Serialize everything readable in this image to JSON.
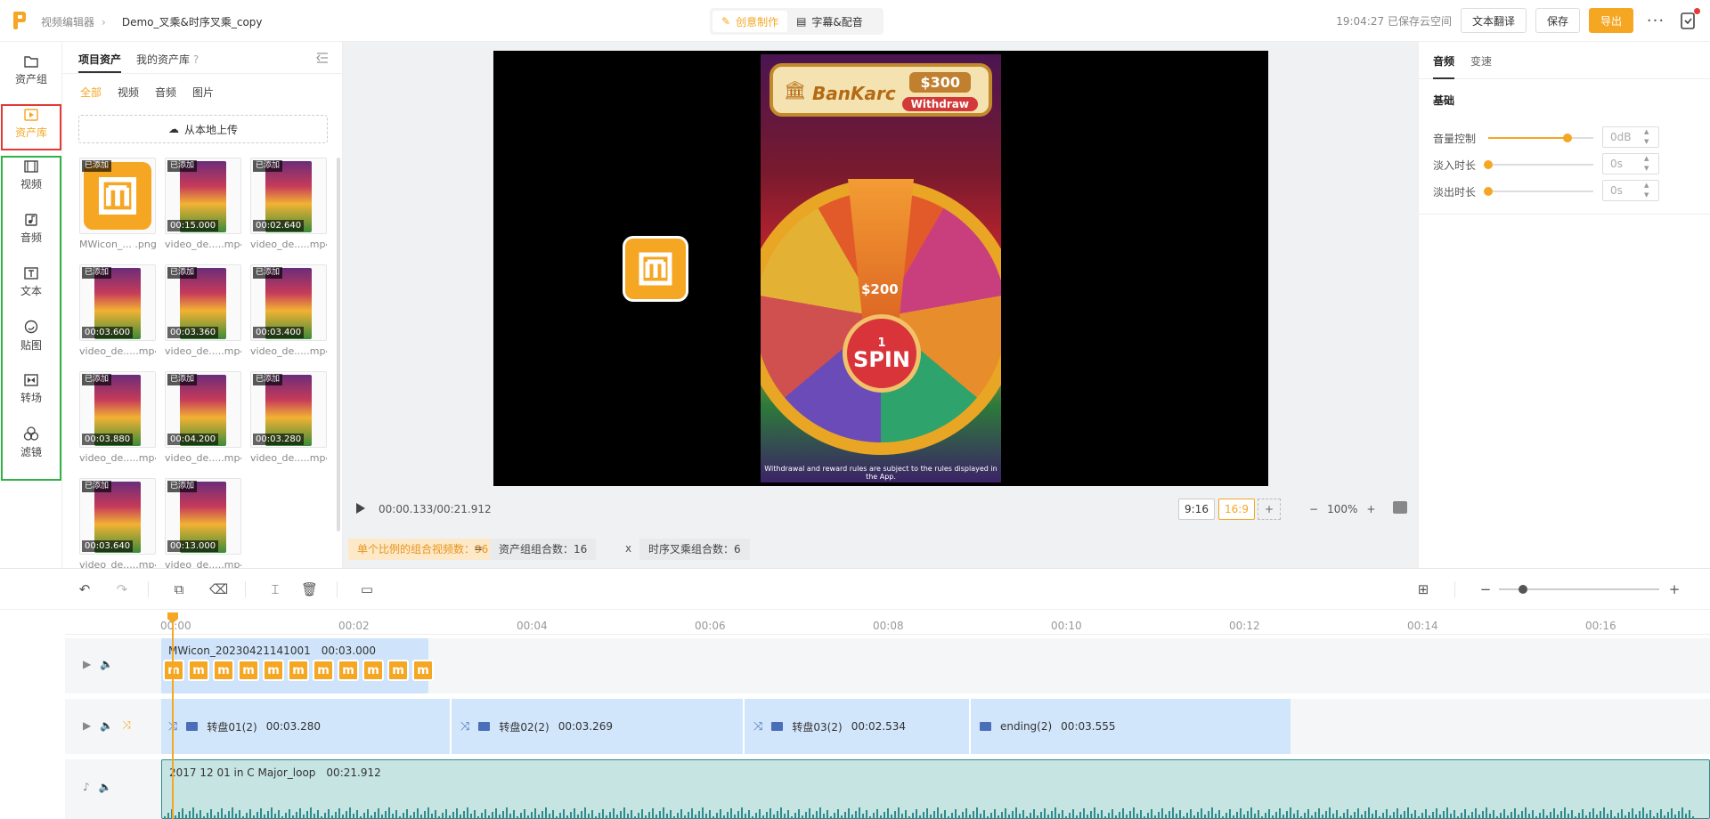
{
  "header": {
    "app_name": "视频编辑器",
    "project_name": "Demo_叉乘&时序叉乘_copy",
    "modes": [
      "创意制作",
      "字幕&配音"
    ],
    "save_status": "19:04:27 已保存云空间",
    "translate_label": "文本翻译",
    "save_label": "保存",
    "export_label": "导出",
    "more_label": "···"
  },
  "leftnav": [
    {
      "label": "资产组",
      "icon": "folder-icon"
    },
    {
      "label": "资产库",
      "icon": "play-square-icon"
    },
    {
      "label": "视频",
      "icon": "film-icon"
    },
    {
      "label": "音频",
      "icon": "music-icon"
    },
    {
      "label": "文本",
      "icon": "text-icon"
    },
    {
      "label": "贴图",
      "icon": "sticker-icon"
    },
    {
      "label": "转场",
      "icon": "transition-icon"
    },
    {
      "label": "滤镜",
      "icon": "filter-icon"
    }
  ],
  "assets": {
    "tabs": [
      "项目资产",
      "我的资产库"
    ],
    "filters": [
      "全部",
      "视频",
      "音频",
      "图片"
    ],
    "upload_label": "从本地上传",
    "added_badge": "已添加",
    "items": [
      {
        "name": "MWicon_... .png",
        "duration": "",
        "kind": "image"
      },
      {
        "name": "video_de.....mp4",
        "duration": "00:15.000",
        "kind": "video"
      },
      {
        "name": "video_de.....mp4",
        "duration": "00:02.640",
        "kind": "video"
      },
      {
        "name": "video_de.....mp4",
        "duration": "00:03.600",
        "kind": "video"
      },
      {
        "name": "video_de.....mp4",
        "duration": "00:03.360",
        "kind": "video"
      },
      {
        "name": "video_de.....mp4",
        "duration": "00:03.400",
        "kind": "video"
      },
      {
        "name": "video_de.....mp4",
        "duration": "00:03.880",
        "kind": "video"
      },
      {
        "name": "video_de.....mp4",
        "duration": "00:04.200",
        "kind": "video"
      },
      {
        "name": "video_de.....mp4",
        "duration": "00:03.280",
        "kind": "video"
      },
      {
        "name": "video_de.....mp4",
        "duration": "00:03.640",
        "kind": "video"
      },
      {
        "name": "video_de.....mp4",
        "duration": "00:13.000",
        "kind": "video"
      }
    ]
  },
  "preview": {
    "game": {
      "brand": "BanKarc",
      "balance": "$300",
      "withdraw": "Withdraw",
      "prize": "$200",
      "spin_count": "1",
      "spin_label": "SPIN",
      "disclaimer": "Withdrawal and reward rules are subject to the rules displayed in the App."
    },
    "time": "00:00.133/00:21.912",
    "ratios": [
      "9:16",
      "16:9"
    ],
    "ratio_add": "+",
    "zoom_minus": "−",
    "zoom_value": "100%",
    "zoom_plus": "+"
  },
  "combo": {
    "total_label": "单个比例的组合视频数：",
    "total_value": "96",
    "eq": "=",
    "group_label": "资产组组合数：",
    "group_value": "16",
    "times": "x",
    "seq_label": "时序叉乘组合数：",
    "seq_value": "6"
  },
  "props": {
    "tabs": [
      "音频",
      "变速"
    ],
    "section": "基础",
    "rows": [
      {
        "label": "音量控制",
        "value": "0dB",
        "level": 0.75
      },
      {
        "label": "淡入时长",
        "value": "0s",
        "level": 0
      },
      {
        "label": "淡出时长",
        "value": "0s",
        "level": 0
      }
    ]
  },
  "timeline": {
    "ticks": [
      "00:00",
      "00:02",
      "00:04",
      "00:06",
      "00:08",
      "00:10",
      "00:12",
      "00:14",
      "00:16"
    ],
    "icon_track": {
      "name": "MWicon_20230421141001",
      "duration": "00:03.000"
    },
    "segments": [
      {
        "name": "转盘01(2)",
        "duration": "00:03.280"
      },
      {
        "name": "转盘02(2)",
        "duration": "00:03.269"
      },
      {
        "name": "转盘03(2)",
        "duration": "00:02.534"
      },
      {
        "name": "ending(2)",
        "duration": "00:03.555"
      }
    ],
    "audio": {
      "name": "2017 12 01 in C Major_loop",
      "duration": "00:21.912"
    }
  }
}
